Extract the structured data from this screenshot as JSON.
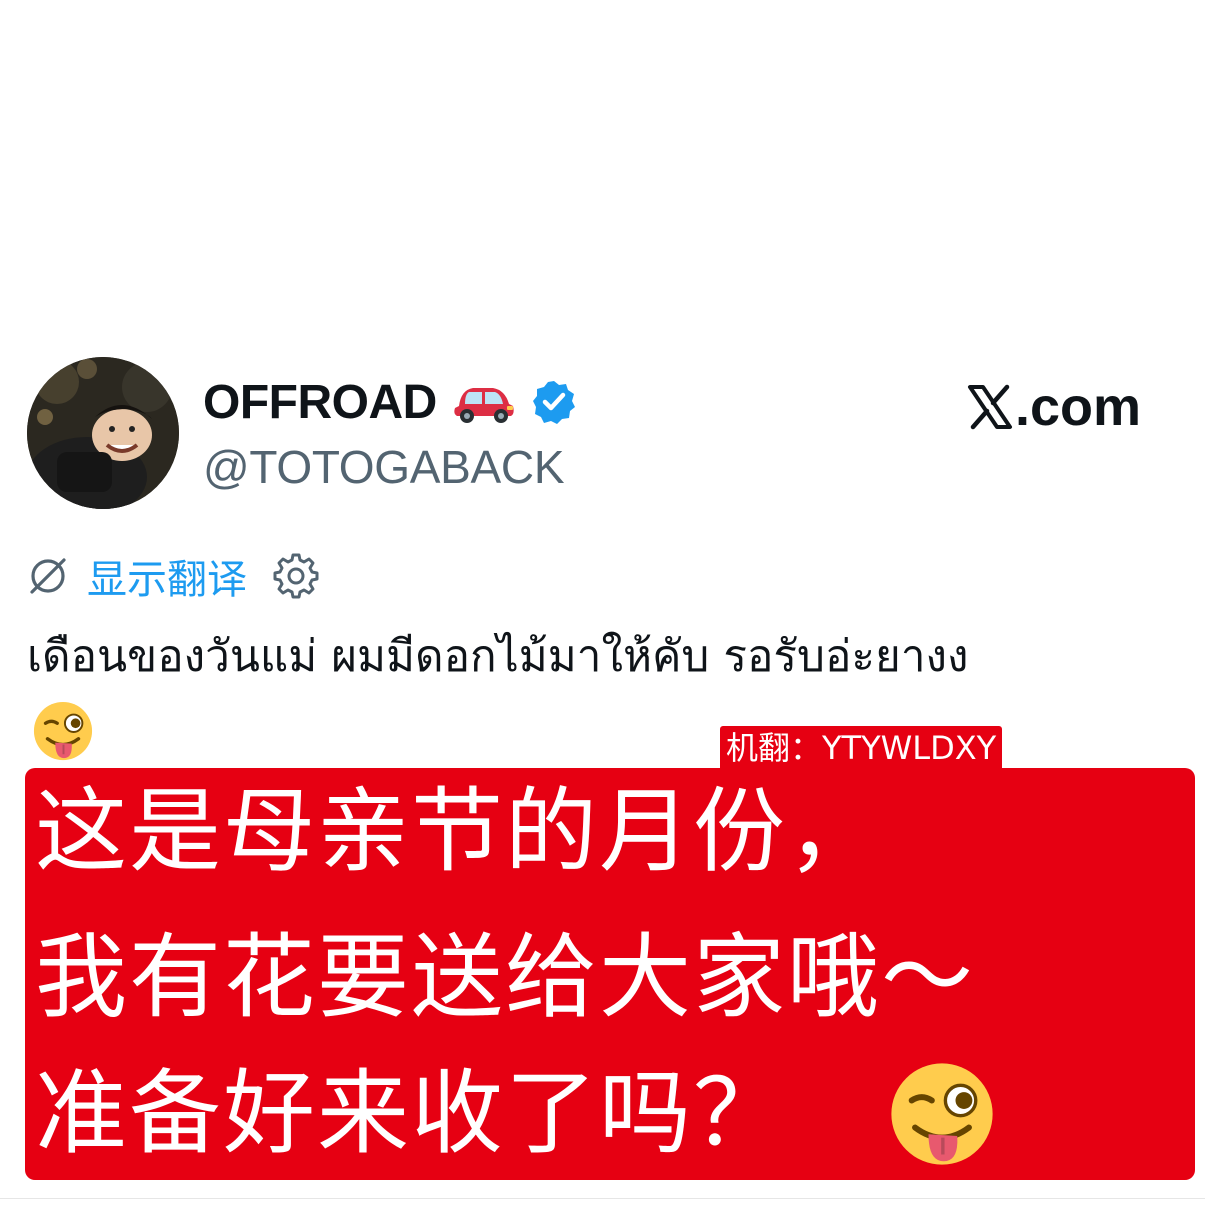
{
  "profile": {
    "display_name": "OFFROAD",
    "name_emoji": "red-car-emoji",
    "verified_badge": "verified-badge-icon",
    "handle": "@TOTOGABACK"
  },
  "source": {
    "logo": "x-logo-icon",
    "domain_suffix": ".com"
  },
  "translate": {
    "link_label": "显示翻译",
    "globe_icon": "globe-icon",
    "settings_icon": "gear-icon"
  },
  "tweet": {
    "text": "เดือนของวันแม่ ผมมีดอกไม้มาให้คับ รอรับอ่ะยางง",
    "emoji": "winking-tongue-emoji"
  },
  "machine_translation": {
    "tag_label": "机翻：YTYWLDXY",
    "lines": [
      "这是母亲节的月份，",
      "我有花要送给大家哦～",
      "准备好来收了吗？"
    ],
    "emoji": "winking-tongue-emoji"
  },
  "colors": {
    "accent_blue": "#1d9bf0",
    "verified_blue": "#1d9bf0",
    "translation_red": "#e60012",
    "text_primary": "#0f1419",
    "text_secondary": "#536471"
  }
}
